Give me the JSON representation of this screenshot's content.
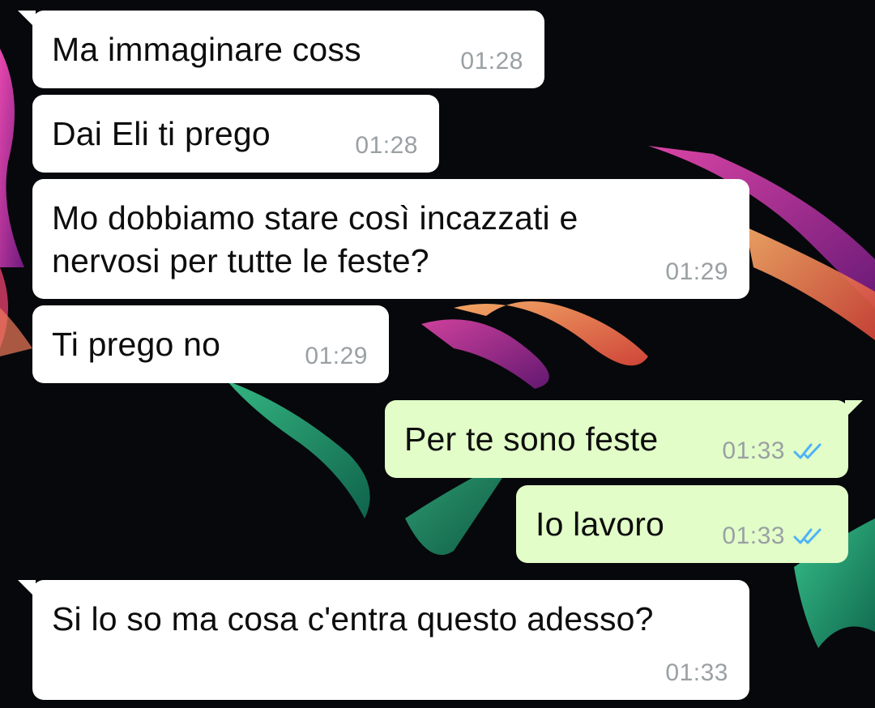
{
  "colors": {
    "incoming_bubble": "#ffffff",
    "outgoing_bubble": "#e2fdc8",
    "time_text": "#9aa0a3",
    "read_ticks": "#4fb3f6"
  },
  "messages": [
    {
      "direction": "incoming",
      "text": "Ma immaginare coss",
      "time": "01:28"
    },
    {
      "direction": "incoming",
      "text": "Dai Eli ti prego",
      "time": "01:28"
    },
    {
      "direction": "incoming",
      "text": "Mo dobbiamo stare così incazzati e\nnervosi per tutte le feste?",
      "time": "01:29"
    },
    {
      "direction": "incoming",
      "text": "Ti prego no",
      "time": "01:29"
    },
    {
      "direction": "outgoing",
      "text": "Per te sono feste",
      "time": "01:33",
      "status_icon": "double-check-read-icon"
    },
    {
      "direction": "outgoing",
      "text": "Io lavoro",
      "time": "01:33",
      "status_icon": "double-check-read-icon"
    },
    {
      "direction": "incoming",
      "text": "Si lo so ma cosa c'entra questo adesso?",
      "time": "01:33"
    }
  ]
}
